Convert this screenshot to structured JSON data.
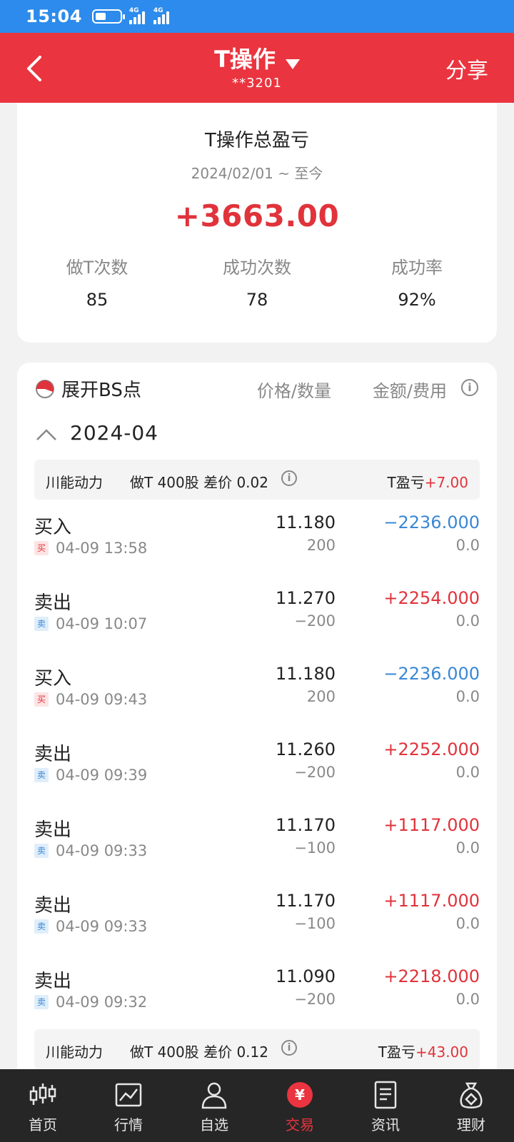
{
  "status_bar": {
    "time": "15:04",
    "network_1": "4G",
    "network_2": "4G"
  },
  "header": {
    "title": "T操作",
    "account": "**3201",
    "share_label": "分享",
    "background": "#ea343f"
  },
  "summary": {
    "title": "T操作总盈亏",
    "date_range": "2024/02/01 ~ 至今",
    "total_pnl": "+3663.00",
    "stats": [
      {
        "label": "做T次数",
        "value": "85"
      },
      {
        "label": "成功次数",
        "value": "78"
      },
      {
        "label": "成功率",
        "value": "92%"
      }
    ]
  },
  "detail": {
    "bs_toggle_label": "展开BS点",
    "col_price_qty": "价格/数量",
    "col_amount_fee": "金额/费用",
    "month": "2024-04",
    "groups": [
      {
        "stock": "川能动力",
        "desc": "做T 400股 差价 0.02",
        "pnl_label": "T盈亏",
        "pnl_value": "+7.00"
      },
      {
        "stock": "川能动力",
        "desc": "做T 400股 差价 0.12",
        "pnl_label": "T盈亏",
        "pnl_value": "+43.00"
      }
    ],
    "trades": [
      {
        "action": "买入",
        "badge": "买",
        "time": "04-09 13:58",
        "price": "11.180",
        "qty": "200",
        "amount": "−2236.000",
        "fee": "0.0",
        "side": "buy"
      },
      {
        "action": "卖出",
        "badge": "卖",
        "time": "04-09 10:07",
        "price": "11.270",
        "qty": "−200",
        "amount": "+2254.000",
        "fee": "0.0",
        "side": "sell"
      },
      {
        "action": "买入",
        "badge": "买",
        "time": "04-09 09:43",
        "price": "11.180",
        "qty": "200",
        "amount": "−2236.000",
        "fee": "0.0",
        "side": "buy"
      },
      {
        "action": "卖出",
        "badge": "卖",
        "time": "04-09 09:39",
        "price": "11.260",
        "qty": "−200",
        "amount": "+2252.000",
        "fee": "0.0",
        "side": "sell"
      },
      {
        "action": "卖出",
        "badge": "卖",
        "time": "04-09 09:33",
        "price": "11.170",
        "qty": "−100",
        "amount": "+1117.000",
        "fee": "0.0",
        "side": "sell"
      },
      {
        "action": "卖出",
        "badge": "卖",
        "time": "04-09 09:33",
        "price": "11.170",
        "qty": "−100",
        "amount": "+1117.000",
        "fee": "0.0",
        "side": "sell"
      },
      {
        "action": "卖出",
        "badge": "卖",
        "time": "04-09 09:32",
        "price": "11.090",
        "qty": "−200",
        "amount": "+2218.000",
        "fee": "0.0",
        "side": "sell"
      }
    ]
  },
  "bottom_nav": [
    {
      "label": "首页",
      "icon": "candlestick-icon"
    },
    {
      "label": "行情",
      "icon": "chart-icon"
    },
    {
      "label": "自选",
      "icon": "person-icon"
    },
    {
      "label": "交易",
      "icon": "yuan-icon",
      "active": true
    },
    {
      "label": "资讯",
      "icon": "document-icon"
    },
    {
      "label": "理财",
      "icon": "money-bag-icon"
    }
  ]
}
